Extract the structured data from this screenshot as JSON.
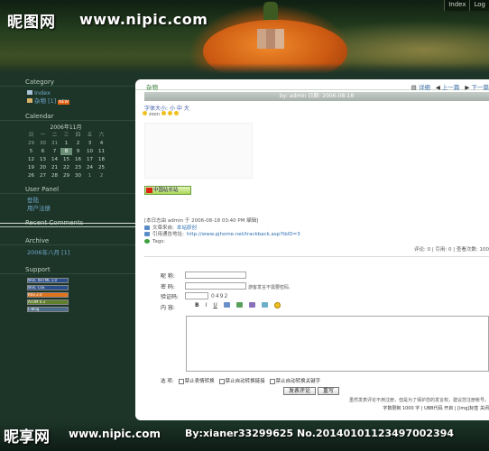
{
  "header": {
    "logo": "昵图网",
    "url": "www.nipic.com",
    "top_nav": [
      "Index",
      "Log"
    ]
  },
  "sidebar": {
    "category_title": "Category",
    "category_items": [
      {
        "label": "Index"
      },
      {
        "label": "杂物 [1]",
        "badge": "NEW"
      }
    ],
    "calendar_title": "Calendar",
    "calendar_month": "2006年11月",
    "calendar_weekdays": [
      "日",
      "一",
      "二",
      "三",
      "四",
      "五",
      "六"
    ],
    "calendar_days": [
      "29",
      "30",
      "31",
      "1",
      "2",
      "3",
      "4",
      "5",
      "6",
      "7",
      "8",
      "9",
      "10",
      "11",
      "12",
      "13",
      "14",
      "15",
      "16",
      "17",
      "18",
      "19",
      "20",
      "21",
      "22",
      "23",
      "24",
      "25",
      "26",
      "27",
      "28",
      "29",
      "30",
      "1",
      "2"
    ],
    "calendar_today_index": 10,
    "user_panel_title": "User Panel",
    "user_panel_items": [
      "登陆",
      "用户注册"
    ],
    "recent_comments_title": "Recent Comments",
    "archive_title": "Archive",
    "archive_items": [
      "2006年八月 [1]"
    ],
    "support_title": "Support",
    "support_badges": [
      {
        "label": "W3C XHTML 1.0",
        "color": "#2b4f8a"
      },
      {
        "label": "W3C CSS",
        "color": "#2b4f8a"
      },
      {
        "label": "RSS 2.0",
        "color": "#e0731c"
      },
      {
        "label": "ATOM 0.3",
        "color": "#5f7f2a"
      },
      {
        "label": "L-Blog",
        "color": "#4a6b8a"
      }
    ]
  },
  "post": {
    "category_link": "杂物",
    "toolbar_items": [
      {
        "icon": "article-icon",
        "label": "详细"
      },
      {
        "icon": "prev-icon",
        "label": "上一篇"
      },
      {
        "icon": "next-icon",
        "label": "下一篇"
      }
    ],
    "title_bar": "by: admin  日期: 2006-08-18",
    "font_size_label": "字体大小:",
    "font_sizes": [
      "小",
      "中",
      "大"
    ],
    "weather_label": "zoon",
    "badge_label": "中国站长站",
    "meta_line": "[本日志由 admin 于 2006-08-18 03:40 PM 编辑]",
    "source_label": "文章来自:",
    "source_link": "本站原创",
    "trackback_label": "引用通告地址:",
    "trackback_url": "http://www.pjhome.net/trackback.asp?tbID=3",
    "tags_label": "Tags:",
    "stats": "评论: 0 | 引用: 0 | 查看次数: 100"
  },
  "comment_form": {
    "nickname_label": "昵  称:",
    "password_label": "密  码:",
    "password_hint": "游客发言不需要密码.",
    "captcha_label": "验证码:",
    "captcha_code": "0492",
    "content_label": "内  容:",
    "toolbar": [
      "B",
      "I",
      "U"
    ],
    "options_label": "选  项:",
    "options": [
      "禁止表情转换",
      "禁止自动转换链接",
      "禁止自动转换关键字"
    ],
    "submit_label": "发表评论",
    "reset_label": "重写",
    "notice": "虽然发表评论不用注册，但是为了保护您的发言权，建议您注册帐号。",
    "limits": "字数限制 1000 字 | UBB代码 开启 | [img]标签 关闭"
  },
  "footer": {
    "watermark_logo": "昵享网",
    "watermark_url": "www.nipic.com",
    "watermark_by": "By:xianer33299625  No.20140101123497002394"
  }
}
